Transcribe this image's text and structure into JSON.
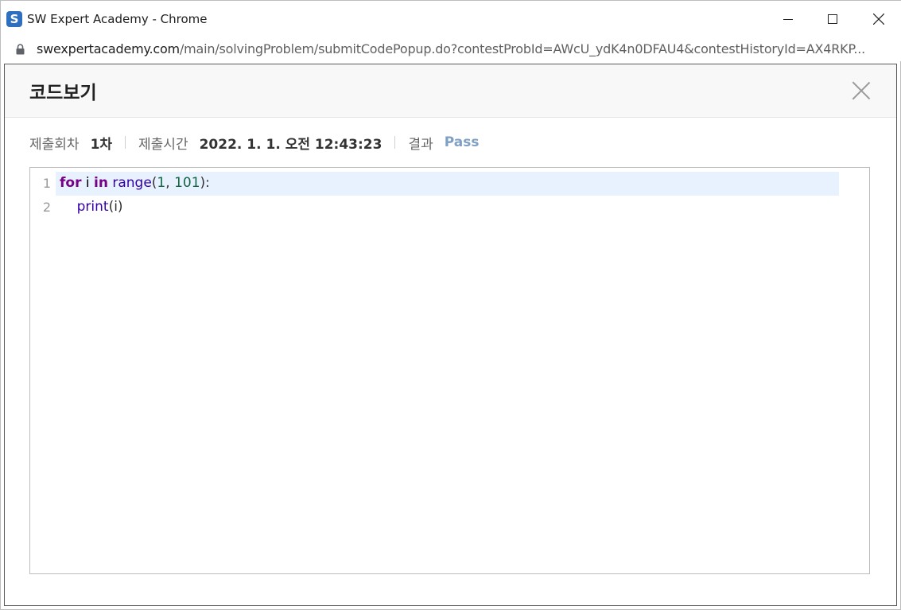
{
  "window": {
    "title": "SW Expert Academy - Chrome",
    "app_icon_letter": "S"
  },
  "address": {
    "host": "swexpertacademy.com",
    "path": "/main/solvingProblem/submitCodePopup.do?contestProbId=AWcU_ydK4n0DFAU4&contestHistoryId=AX4RKP..."
  },
  "popup": {
    "title": "코드보기",
    "meta": {
      "attempt_label": "제출회차",
      "attempt_value": "1차",
      "time_label": "제출시간",
      "time_value": "2022. 1. 1. 오전 12:43:23",
      "result_label": "결과",
      "result_value": "Pass"
    },
    "code": {
      "language": "python",
      "lines": [
        {
          "number": "1",
          "tokens": [
            {
              "text": "for",
              "kind": "keyword"
            },
            {
              "text": " i ",
              "kind": "variable"
            },
            {
              "text": "in",
              "kind": "keyword"
            },
            {
              "text": " ",
              "kind": "plain"
            },
            {
              "text": "range",
              "kind": "builtin"
            },
            {
              "text": "(",
              "kind": "plain"
            },
            {
              "text": "1",
              "kind": "number"
            },
            {
              "text": ", ",
              "kind": "plain"
            },
            {
              "text": "101",
              "kind": "number"
            },
            {
              "text": "):",
              "kind": "plain"
            }
          ]
        },
        {
          "number": "2",
          "tokens": [
            {
              "text": "    ",
              "kind": "plain"
            },
            {
              "text": "print",
              "kind": "builtin"
            },
            {
              "text": "(i)",
              "kind": "plain"
            }
          ]
        }
      ]
    }
  },
  "colors": {
    "keyword": "#770088",
    "builtin": "#3300aa",
    "number": "#116644",
    "pass": "#7f9fc4",
    "active_line": "#e8f2fe"
  }
}
